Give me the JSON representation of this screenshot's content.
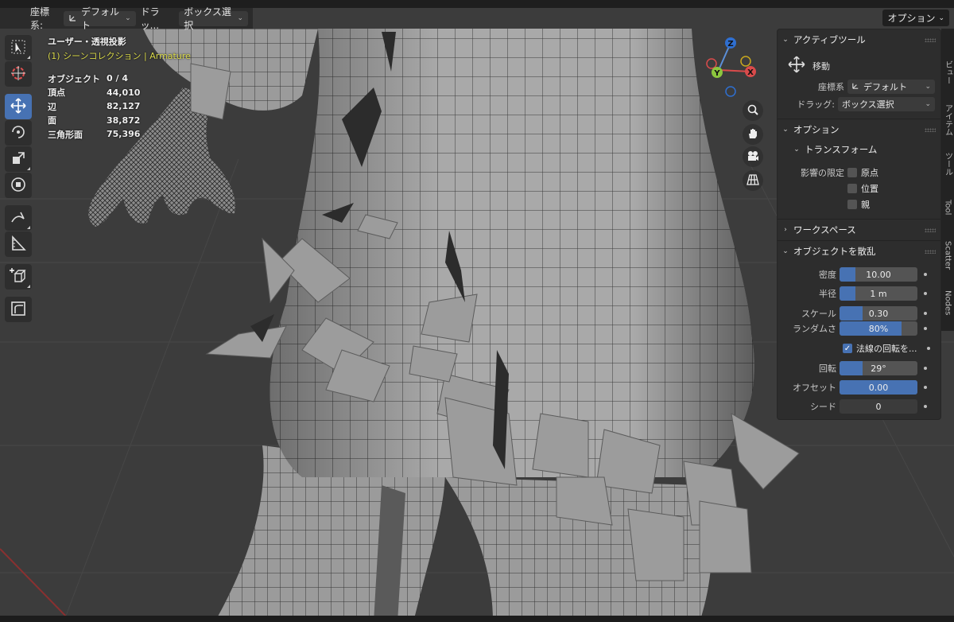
{
  "header": {
    "coord_label": "座標系:",
    "coord_value": "デフォルト",
    "drag_label": "ドラッ...",
    "drag_value": "ボックス選択",
    "options_button": "オプション"
  },
  "overlay": {
    "view_title": "ユーザー・透視投影",
    "collection": "(1) シーンコレクション | Armature",
    "stats": [
      {
        "label": "オブジェクト",
        "value": "0 / 4"
      },
      {
        "label": "頂点",
        "value": "44,010"
      },
      {
        "label": "辺",
        "value": "82,127"
      },
      {
        "label": "面",
        "value": "38,872"
      },
      {
        "label": "三角形面",
        "value": "75,396"
      }
    ]
  },
  "toolbar": {
    "tools": [
      "select-box-icon",
      "cursor-icon",
      "move-icon",
      "rotate-icon",
      "scale-icon",
      "transform-icon",
      "annotate-icon",
      "measure-icon",
      "add-cube-icon",
      "scatter-icon"
    ],
    "active": "move-icon"
  },
  "gizmo": {
    "z": "Z",
    "y": "Y",
    "x": "X"
  },
  "panel": {
    "active_tool": {
      "title": "アクティブツール",
      "tool_name": "移動",
      "coord_label": "座標系",
      "coord_value": "デフォルト",
      "drag_label": "ドラッグ:",
      "drag_value": "ボックス選択"
    },
    "options": {
      "title": "オプション",
      "transform_title": "トランスフォーム",
      "affect_label": "影響の限定",
      "checkboxes": [
        "原点",
        "位置",
        "親"
      ]
    },
    "workspace": {
      "title": "ワークスペース"
    },
    "scatter": {
      "title": "オブジェクトを散乱",
      "density": {
        "label": "密度",
        "value": "10.00",
        "fill": 0.2
      },
      "radius": {
        "label": "半径",
        "value": "1 m",
        "fill": 0.2
      },
      "scale": {
        "label": "スケール",
        "value": "0.30",
        "fill": 0.3
      },
      "randomness": {
        "label": "ランダムさ",
        "value": "80%",
        "fill": 0.8
      },
      "normal_rotation": {
        "label": "法線の回転を...",
        "checked": true
      },
      "rotation": {
        "label": "回転",
        "value": "29°",
        "fill": 0.3
      },
      "offset": {
        "label": "オフセット",
        "value": "0.00",
        "fill": 1.0
      },
      "seed": {
        "label": "シード",
        "value": "0",
        "fill": 0
      }
    }
  },
  "side_tabs": [
    "ビュー",
    "アイテム",
    "ツール",
    "Tool",
    "Scatter",
    "Nodes"
  ],
  "colors": {
    "accent": "#4772b3",
    "panel_bg": "#2d2d2d",
    "viewport_bg": "#3d3d3d",
    "collection_text": "#d9d94a"
  }
}
